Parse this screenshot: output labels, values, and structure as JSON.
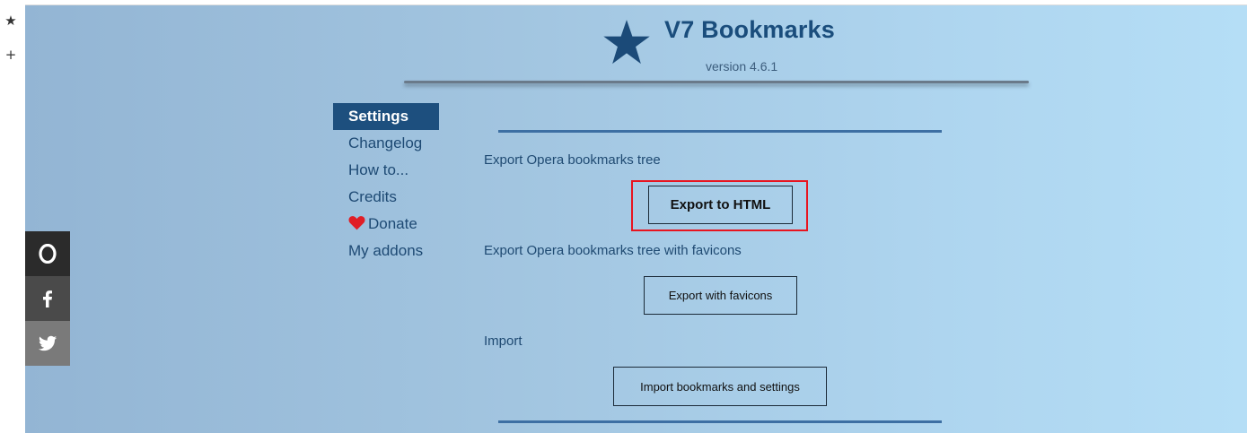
{
  "header": {
    "title": "V7 Bookmarks",
    "version": "version 4.6.1"
  },
  "browser_sidebar": {
    "bookmarks_icon": "star-icon",
    "add_icon": "plus-icon"
  },
  "nav": {
    "items": [
      {
        "label": "Settings",
        "active": true
      },
      {
        "label": "Changelog"
      },
      {
        "label": "How to..."
      },
      {
        "label": "Credits"
      },
      {
        "label": "Donate",
        "icon": "heart-icon"
      },
      {
        "label": "My addons"
      }
    ]
  },
  "sections": {
    "export": {
      "label": "Export Opera bookmarks tree",
      "button": "Export to HTML"
    },
    "favicons": {
      "label": "Export Opera bookmarks tree with favicons",
      "button": "Export with favicons"
    },
    "import": {
      "label": "Import",
      "button": "Import bookmarks and settings"
    }
  },
  "social": [
    {
      "name": "opera-icon",
      "glyph": "O",
      "color": "#2b2b2b"
    },
    {
      "name": "facebook-icon",
      "glyph": "f",
      "color": "#4a4a4a"
    },
    {
      "name": "twitter-icon",
      "glyph": "twitter",
      "color": "#7a7a7a"
    }
  ],
  "colors": {
    "accent": "#1d4f7e",
    "highlight": "#e8141f",
    "heart": "#e01e26"
  }
}
